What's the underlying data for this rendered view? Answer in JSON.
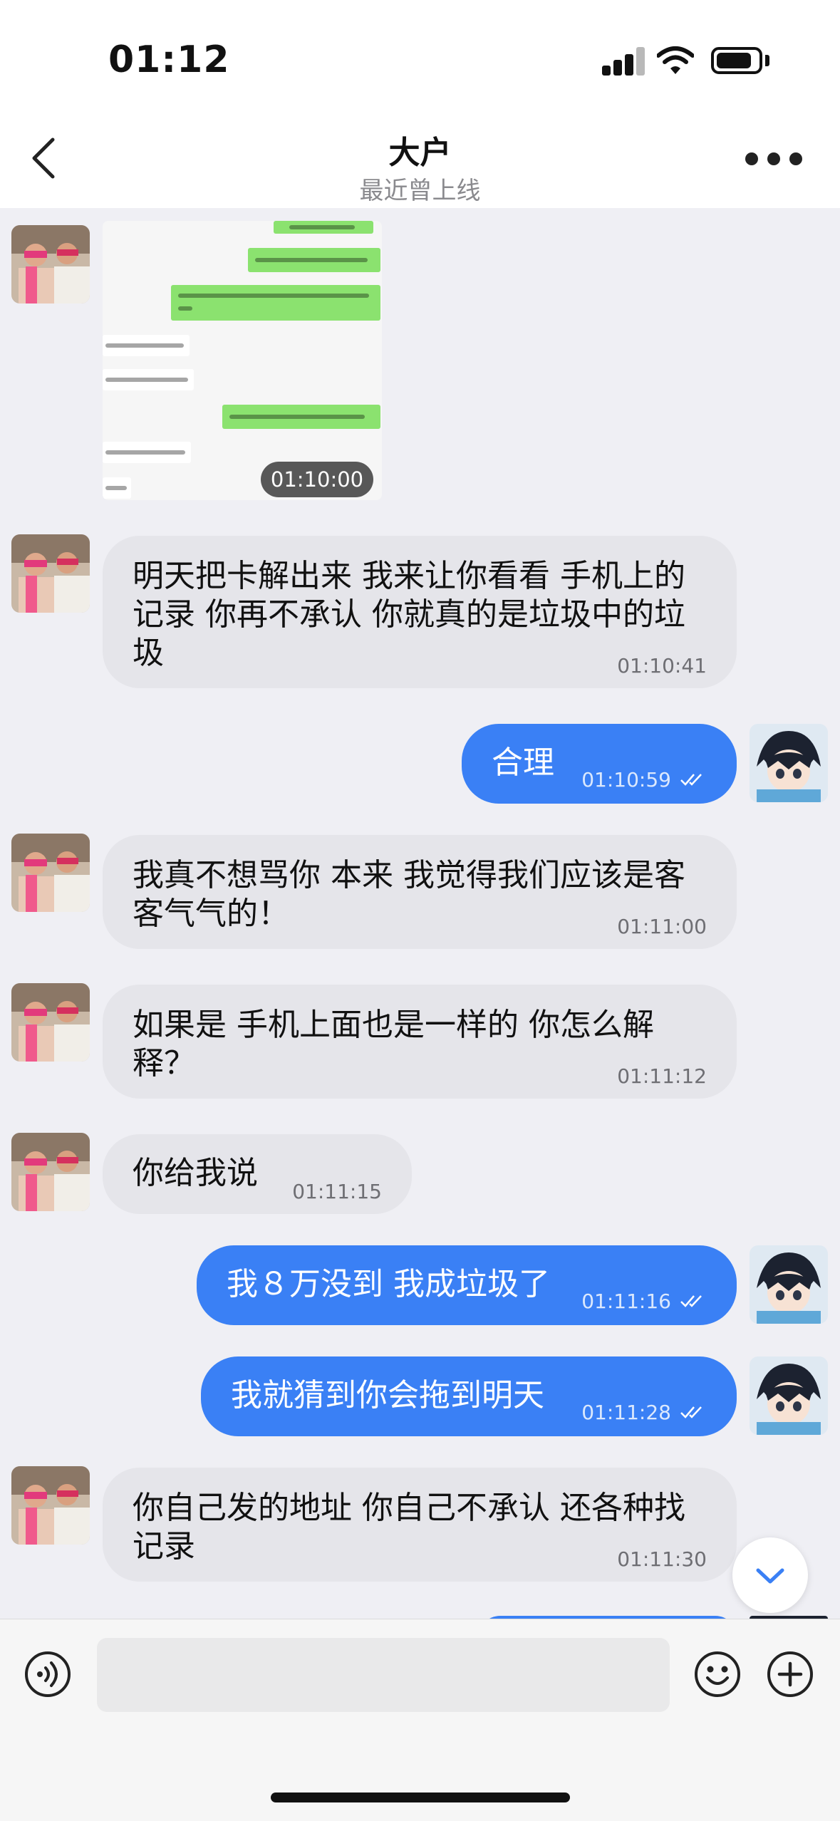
{
  "status_bar": {
    "time": "01:12"
  },
  "header": {
    "title": "大户",
    "subtitle": "最近曾上线"
  },
  "image_message": {
    "time": "01:10:00",
    "screenshot_lines": [
      "叫转销",
      "你不想加载 从这里可以看 聊天",
      "我们是说这是手机上 从这个聊天 发现 你这里你的 他",
      "聊天记录都 了 对的",
      "你一天的 是可以聊这个",
      "你说这么多了 现在是说你咋就不对",
      "你们这里这么多人 工",
      "那些"
    ]
  },
  "messages": [
    {
      "id": "m1",
      "side": "in",
      "text": "明天把卡解出来  我来让你看看 手机上的记录   你再不承认 你就真的是垃圾中的垃圾",
      "time": "01:10:41"
    },
    {
      "id": "m2",
      "side": "out",
      "text": "合理",
      "time": "01:10:59"
    },
    {
      "id": "m3",
      "side": "in",
      "text": "我真不想骂你  本来 我觉得我们应该是客客气气的！",
      "time": "01:11:00"
    },
    {
      "id": "m4",
      "side": "in",
      "text": "如果是 手机上面也是一样的  你怎么解释？",
      "time": "01:11:12"
    },
    {
      "id": "m5",
      "side": "in",
      "text": "你给我说",
      "time": "01:11:15"
    },
    {
      "id": "m6",
      "side": "out",
      "text": "我８万没到 我成垃圾了",
      "time": "01:11:16"
    },
    {
      "id": "m7",
      "side": "out",
      "text": "我就猜到你会拖到明天",
      "time": "01:11:28"
    },
    {
      "id": "m8",
      "side": "in",
      "text": "你自己发的地址  你自己不承认  还各种找记录",
      "time": "01:11:30"
    }
  ],
  "input": {
    "placeholder": ""
  },
  "icons": {
    "back": "chevron-left-icon",
    "more": "more-dots-icon",
    "voice": "voice-icon",
    "emoji": "emoji-icon",
    "plus": "plus-icon",
    "scroll": "chevron-down-icon",
    "read": "double-check-icon"
  },
  "colors": {
    "outgoing_bubble": "#3a80f5",
    "incoming_bubble": "#e5e5ea",
    "background": "#efeff4"
  }
}
